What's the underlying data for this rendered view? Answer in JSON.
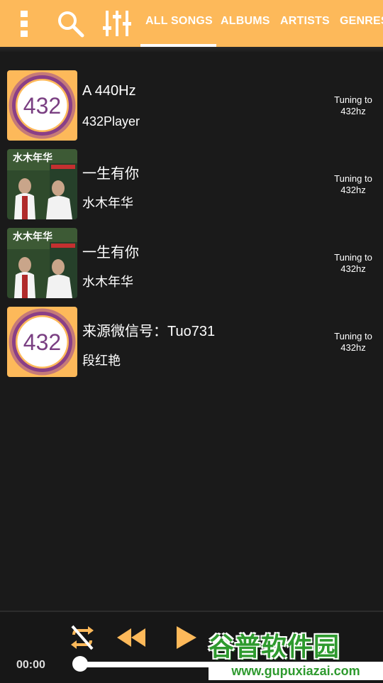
{
  "toolbar": {
    "menu_icon": "more-vert-icon",
    "search_icon": "search-icon",
    "equalizer_icon": "equalizer-icon"
  },
  "tabs": [
    {
      "label": "ALL SONGS",
      "active": true
    },
    {
      "label": "ALBUMS",
      "active": false
    },
    {
      "label": "ARTISTS",
      "active": false
    },
    {
      "label": "GENRES",
      "active": false
    }
  ],
  "songs": [
    {
      "title": "A 440Hz",
      "artist": "432Player",
      "tuning": "Tuning to 432hz",
      "art": "432",
      "art_text": "432"
    },
    {
      "title": "一生有你",
      "artist": "水木年华",
      "tuning": "Tuning to 432hz",
      "art": "album",
      "art_text": "水木年华"
    },
    {
      "title": "一生有你",
      "artist": "水木年华",
      "tuning": "Tuning to 432hz",
      "art": "album",
      "art_text": "水木年华"
    },
    {
      "title": "来源微信号：Tuo731",
      "artist": "段红艳",
      "tuning": "Tuning to 432hz",
      "art": "432",
      "art_text": "432"
    }
  ],
  "player": {
    "time": "00:00",
    "progress": 0,
    "repeat_icon": "repeat-off-icon",
    "previous_icon": "rewind-icon",
    "play_icon": "play-icon"
  },
  "watermark": {
    "title": "谷普软件园",
    "url": "www.gupuxiazai.com"
  },
  "colors": {
    "accent": "#fdb95a",
    "background": "#1a1a1a",
    "watermark_green": "#2e9a2e"
  }
}
